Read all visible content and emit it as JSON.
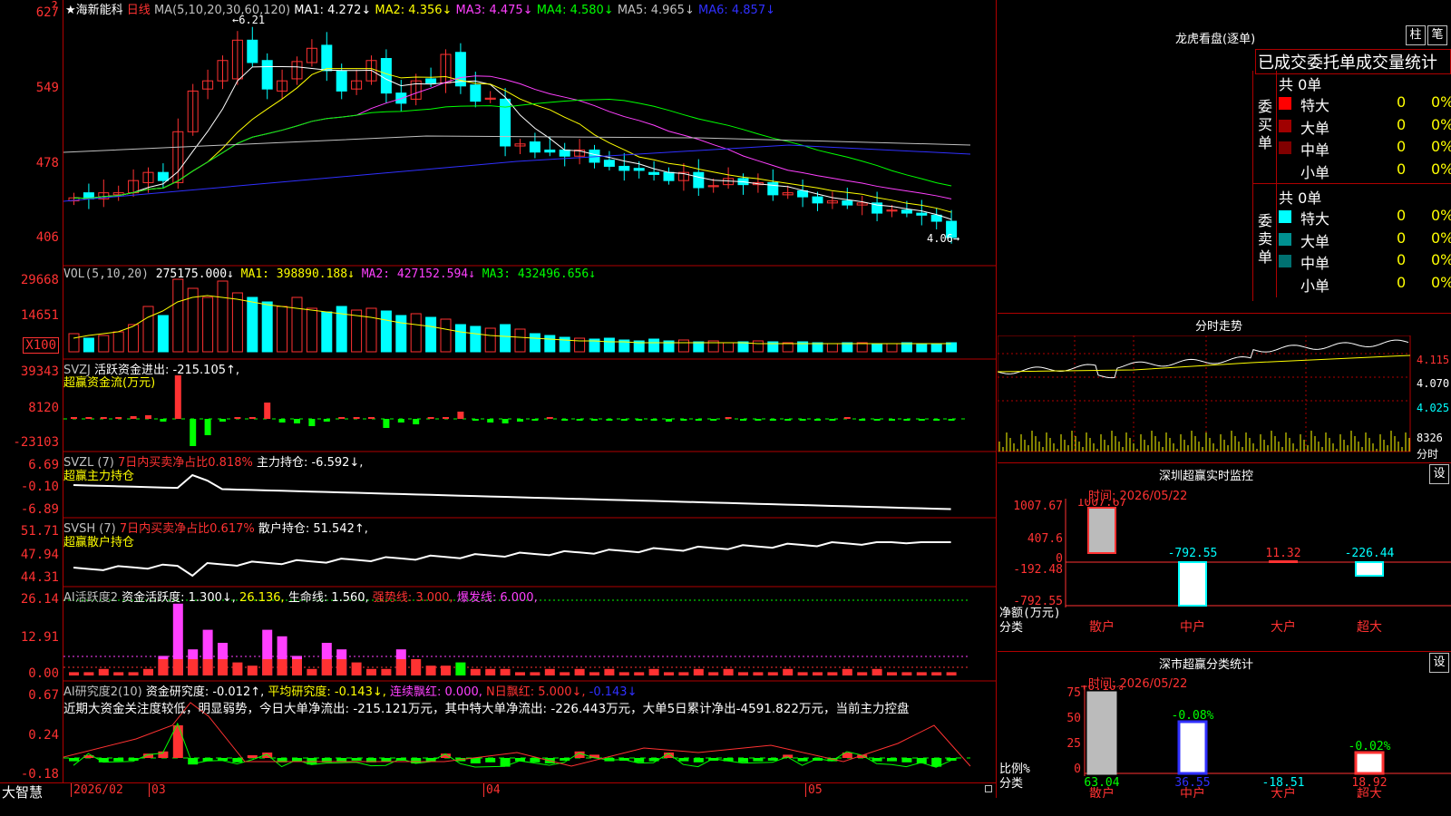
{
  "main": {
    "stock_name": "★海新能科",
    "period": "日线",
    "ma_title": "MA(5,10,20,30,60,120)",
    "ma_items": [
      {
        "label": "MA1: 4.272↓",
        "color": "#ffffff"
      },
      {
        "label": "MA2: 4.356↓",
        "color": "#ffff00"
      },
      {
        "label": "MA3: 4.475↓",
        "color": "#ff40ff"
      },
      {
        "label": "MA4: 4.580↓",
        "color": "#00ff00"
      },
      {
        "label": "MA5: 4.965↓",
        "color": "#c0c0c0"
      },
      {
        "label": "MA6: 4.857↓",
        "color": "#3030ff"
      }
    ],
    "y_labels": [
      "627",
      "549",
      "478",
      "406"
    ],
    "high_mark": "6.21",
    "low_mark": "4.06"
  },
  "vol": {
    "title": "VOL(5,10,20)",
    "value": "275175.000↓",
    "ma_items": [
      {
        "label": "MA1: 398890.188↓",
        "color": "#ffff00"
      },
      {
        "label": "MA2: 427152.594↓",
        "color": "#ff40ff"
      },
      {
        "label": "MA3: 432496.656↓",
        "color": "#00ff00"
      }
    ],
    "y_labels": [
      "29668",
      "14651"
    ],
    "unit": "X100"
  },
  "svzj": {
    "title": "SVZJ",
    "line1": "活跃资金进出: -215.105↑,",
    "line2": "超赢资金流(万元)",
    "y_labels": [
      "39343",
      "8120",
      "-23103"
    ]
  },
  "svzl": {
    "title": "SVZL (7)",
    "desc": "7日内买卖净占比0.818%",
    "hold": "主力持仓: -6.592↓,",
    "line2": "超赢主力持仓",
    "y_labels": [
      "6.69",
      "-0.10",
      "-6.89"
    ]
  },
  "svsh": {
    "title": "SVSH (7)",
    "desc": "7日内买卖净占比0.617%",
    "hold": "散户持仓: 51.542↑,",
    "line2": "超赢散户持仓",
    "y_labels": [
      "51.71",
      "47.94",
      "44.31"
    ]
  },
  "ai2": {
    "title": "AI活跃度2",
    "a": "资金活跃度: 1.300↓,",
    "b": "26.136,",
    "c": "生命线: 1.560,",
    "d": "强势线: 3.000,",
    "e": "爆发线: 6.000,",
    "y_labels": [
      "26.14",
      "12.91",
      "0.00"
    ]
  },
  "ai_research": {
    "title": "AI研究度2(10)",
    "a": "资金研究度: -0.012↑,",
    "b": "平均研究度: -0.143↓,",
    "c": "连续飘红: 0.000,",
    "d": "N日飘红: 5.000↓,",
    "e": "-0.143↓",
    "note": "近期大资金关注度较低，明显弱势，今日大单净流出: -215.121万元，其中特大单净流出: -226.443万元，大单5日累计净出-4591.822万元，当前主力控盘",
    "y_labels": [
      "0.67",
      "0.24",
      "-0.18"
    ]
  },
  "xaxis": {
    "brand": "大智慧",
    "labels": [
      "2026/02",
      "03",
      "04",
      "05"
    ]
  },
  "dragon": {
    "title": "龙虎看盘(逐单)",
    "btn1": "柱",
    "btn2": "笔",
    "header": "已成交委托单成交量统计",
    "buy_label": "委买单",
    "sell_label": "委卖单",
    "buy_total": "共 0单",
    "sell_total": "共 0单",
    "buy_rows": [
      {
        "name": "特大",
        "qty": "0",
        "pct": "0%",
        "color": "#ff0000"
      },
      {
        "name": "大单",
        "qty": "0",
        "pct": "0%",
        "color": "#a00000"
      },
      {
        "name": "中单",
        "qty": "0",
        "pct": "0%",
        "color": "#800000"
      },
      {
        "name": "小单",
        "qty": "0",
        "pct": "0%",
        "color": ""
      }
    ],
    "sell_rows": [
      {
        "name": "特大",
        "qty": "0",
        "pct": "0%",
        "color": "#00ffff"
      },
      {
        "name": "大单",
        "qty": "0",
        "pct": "0%",
        "color": "#009090"
      },
      {
        "name": "中单",
        "qty": "0",
        "pct": "0%",
        "color": "#007070"
      },
      {
        "name": "小单",
        "qty": "0",
        "pct": "0%",
        "color": ""
      }
    ]
  },
  "intraday": {
    "title": "分时走势",
    "prices": [
      "4.115",
      "4.070",
      "4.025"
    ],
    "vol_label": "8326",
    "unit": "分时"
  },
  "sz_monitor": {
    "title": "深圳超赢实时监控",
    "btn": "设",
    "time": "时间: 2026/05/22",
    "y_labels": [
      "1007.67",
      "407.6",
      "0",
      "-192.48",
      "-792.55"
    ],
    "ylabel1": "净额(万元)",
    "ylabel2": "分类",
    "bars": [
      {
        "cat": "散户",
        "value": "1007.67",
        "color": "#ff3232"
      },
      {
        "cat": "中户",
        "value": "-792.55",
        "color": "#00ffff"
      },
      {
        "cat": "大户",
        "value": "11.32",
        "color": "#ff3232"
      },
      {
        "cat": "超大",
        "value": "-226.44",
        "color": "#00ffff"
      }
    ]
  },
  "sz_class": {
    "title": "深市超赢分类统计",
    "btn": "设",
    "time": "时间: 2026/05/22",
    "y_labels": [
      "75",
      "50",
      "25",
      "0"
    ],
    "ylabel1": "比例%",
    "ylabel2": "分类",
    "bars": [
      {
        "cat": "散户",
        "change": "+0.10%",
        "value": "63.04",
        "change_color": "#ff3232",
        "value_color": "#00ff00"
      },
      {
        "cat": "中户",
        "change": "-0.08%",
        "value": "36.55",
        "change_color": "#00ff00",
        "value_color": "#3030ff"
      },
      {
        "cat": "大户",
        "change": "",
        "value": "-18.51",
        "change_color": "#00ff00",
        "value_color": "#00ffff"
      },
      {
        "cat": "超大",
        "change": "-0.02%",
        "value": "18.92",
        "change_color": "#00ff00",
        "value_color": "#ff3232"
      }
    ]
  },
  "chart_data": {
    "type": "candlestick",
    "title": "海新能科 日线",
    "x": [
      "2026/02",
      "03",
      "04",
      "05"
    ],
    "ylim": [
      4.06,
      6.27
    ],
    "last_close": 4.06,
    "high": 6.21
  }
}
